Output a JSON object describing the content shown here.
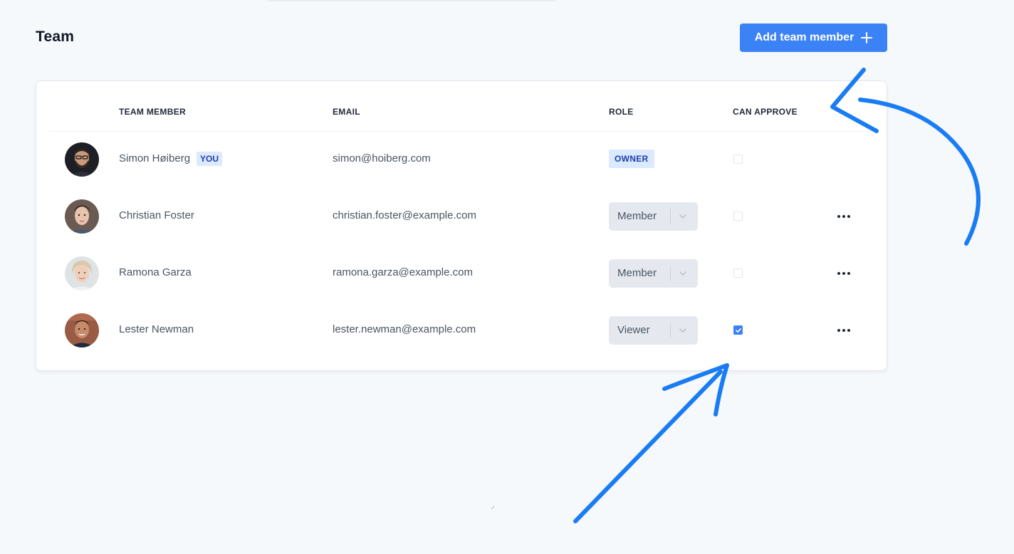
{
  "header": {
    "title": "Team",
    "add_button_label": "Add team member",
    "add_button_icon": "plus-icon"
  },
  "table": {
    "columns": {
      "member": "TEAM MEMBER",
      "email": "EMAIL",
      "role": "ROLE",
      "can_approve": "CAN APPROVE"
    },
    "rows": [
      {
        "name": "Simon Høiberg",
        "badge": "YOU",
        "email": "simon@hoiberg.com",
        "role": "OWNER",
        "role_editable": false,
        "can_approve": false,
        "has_actions": false,
        "avatar": "avatar-photo"
      },
      {
        "name": "Christian Foster",
        "email": "christian.foster@example.com",
        "role": "Member",
        "role_editable": true,
        "can_approve": false,
        "has_actions": true,
        "avatar": "avatar-photo"
      },
      {
        "name": "Ramona Garza",
        "email": "ramona.garza@example.com",
        "role": "Member",
        "role_editable": true,
        "can_approve": false,
        "has_actions": true,
        "avatar": "avatar-photo"
      },
      {
        "name": "Lester Newman",
        "email": "lester.newman@example.com",
        "role": "Viewer",
        "role_editable": true,
        "can_approve": true,
        "has_actions": true,
        "avatar": "avatar-photo"
      }
    ]
  },
  "colors": {
    "accent": "#3b82f6",
    "badge_bg": "#dbeafe",
    "badge_text": "#1e40af",
    "annotation_arrow": "#1a7cf5",
    "page_bg": "#f6f9fc"
  }
}
